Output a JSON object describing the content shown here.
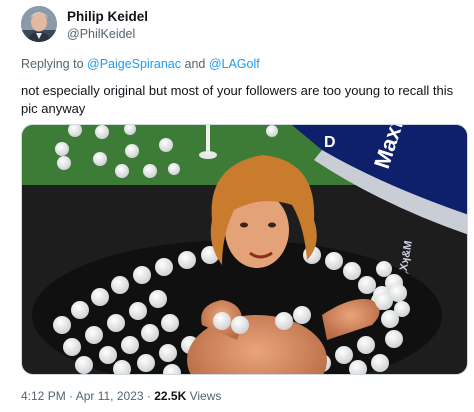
{
  "author": {
    "display_name": "Philip Keidel",
    "handle": "@PhilKeidel"
  },
  "reply": {
    "prefix": "Replying to ",
    "mention_1": "@PaigeSpiranac",
    "conjunction": " and ",
    "mention_2": "@LAGolf"
  },
  "tweet": {
    "text": "not especially original but most of your followers are too young to recall this pic anyway"
  },
  "media": {
    "bag_text_1": "Maxfl",
    "bag_text_2": "D",
    "bag_text_3": "ɟXʞ&M"
  },
  "meta": {
    "time": "4:12 PM",
    "sep_1": " · ",
    "date": "Apr 11, 2023",
    "sep_2": " · ",
    "views_count": "22.5K",
    "views_label": " Views"
  },
  "colors": {
    "link": "#1d9bf0",
    "secondary_text": "#536471",
    "primary_text": "#0f1419"
  }
}
